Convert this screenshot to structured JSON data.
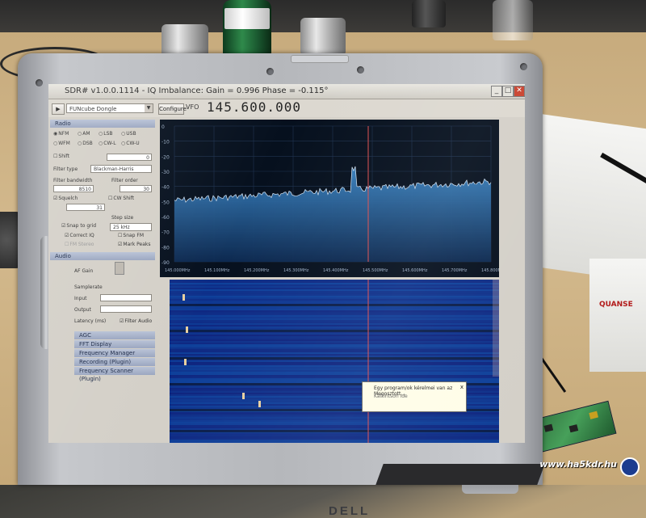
{
  "window": {
    "app_name": "SDR# v1.0.0.1114",
    "title": "SDR# v1.0.0.1114 - IQ Imbalance: Gain = 0.996 Phase = -0.115°",
    "min": "_",
    "max": "□",
    "close": "✕"
  },
  "toolbar": {
    "source": "FUNcube Dongle",
    "configure": "Configure",
    "vfo_label": "VFO",
    "frequency": "145.600.000",
    "play_icon": "play-icon"
  },
  "radio": {
    "header": "Radio",
    "modes": [
      "NFM",
      "AM",
      "LSB",
      "USB",
      "WFM",
      "DSB",
      "CW-L",
      "CW-U"
    ],
    "selected_mode": "NFM",
    "shift_label": "Shift",
    "shift_value": "0",
    "filter_type_label": "Filter type",
    "filter_type": "Blackman-Harris",
    "filter_bandwidth_label": "Filter bandwidth",
    "filter_bandwidth": "8510",
    "filter_order_label": "Filter order",
    "filter_order": "30",
    "squelch_label": "Squelch",
    "squelch_value": "31",
    "cw_shift_label": "CW Shift",
    "step_size_label": "Step size",
    "step_size": "25 kHz",
    "snap_to_grid": "Snap to grid",
    "correct_iq": "Correct IQ",
    "snap_fm": "Snap FM",
    "mark_peaks": "Mark Peaks",
    "fm_stereo": "FM Stereo"
  },
  "audio": {
    "header": "Audio",
    "af_gain": "AF Gain",
    "samplerate": "Samplerate",
    "input": "Input",
    "output": "Output",
    "latency": "Latency (ms)",
    "filter_audio": "Filter Audio"
  },
  "collapsed_groups": [
    "AGC",
    "FFT Display",
    "Frequency Manager (Plugin)",
    "Recording (Plugin)",
    "Frequency Scanner (Plugin)"
  ],
  "spectrum": {
    "y_ticks": [
      "0",
      "-10",
      "-20",
      "-30",
      "-40",
      "-50",
      "-60",
      "-70",
      "-80",
      "-90"
    ],
    "x_ticks": [
      "145.000MHz",
      "145.100MHz",
      "145.200MHz",
      "145.300MHz",
      "145.400MHz",
      "145.500MHz",
      "145.600MHz",
      "145.700MHz",
      "145.800MHz"
    ]
  },
  "popup": {
    "message": "Egy program/ok kérelmei van az Megosztott...",
    "sub": "Kattintson ide",
    "close": "x"
  },
  "laptop": {
    "brand": "DELL"
  },
  "scene": {
    "box_label": "QUANSE",
    "watermark": "www.ha5kdr.hu"
  },
  "colors": {
    "spectrum_fill": "#2a6fa8",
    "waterfall_bg": "#0e2a63",
    "vfo_line": "#e05050"
  }
}
